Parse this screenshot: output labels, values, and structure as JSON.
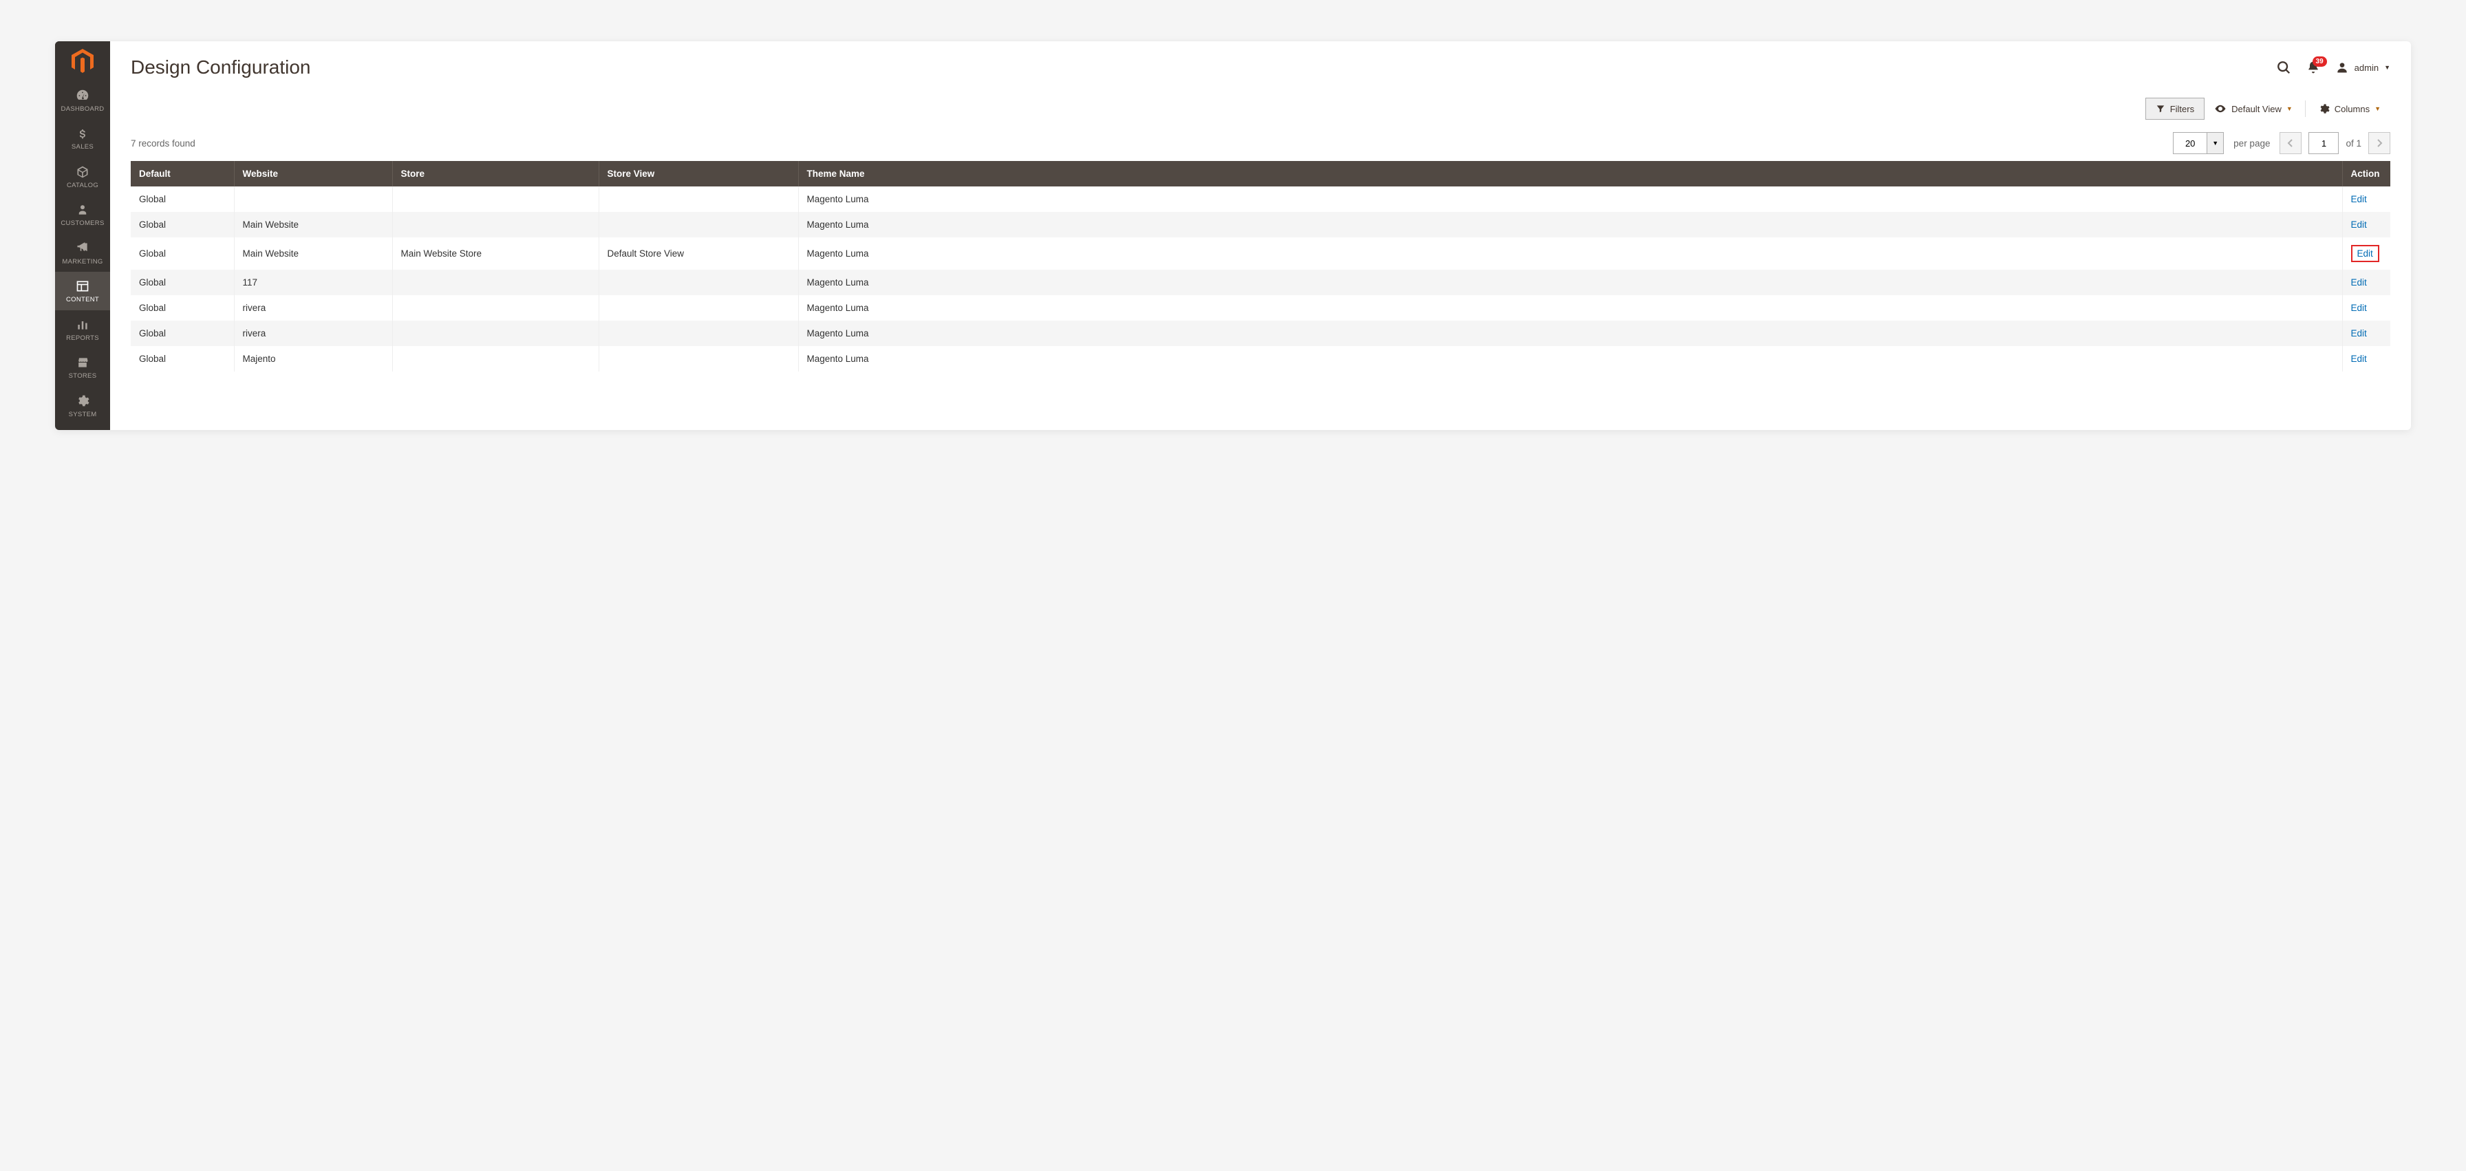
{
  "sidebar": {
    "items": [
      {
        "label": "DASHBOARD",
        "icon": "dashboard"
      },
      {
        "label": "SALES",
        "icon": "dollar"
      },
      {
        "label": "CATALOG",
        "icon": "box"
      },
      {
        "label": "CUSTOMERS",
        "icon": "person"
      },
      {
        "label": "MARKETING",
        "icon": "megaphone"
      },
      {
        "label": "CONTENT",
        "icon": "layout",
        "active": true
      },
      {
        "label": "REPORTS",
        "icon": "bars"
      },
      {
        "label": "STORES",
        "icon": "storefront"
      },
      {
        "label": "SYSTEM",
        "icon": "gear"
      }
    ]
  },
  "header": {
    "title": "Design Configuration",
    "notification_count": "39",
    "user_name": "admin"
  },
  "toolbar": {
    "filters_label": "Filters",
    "default_view_label": "Default View",
    "columns_label": "Columns"
  },
  "pager": {
    "records_found": "7 records found",
    "per_page_value": "20",
    "per_page_label": "per page",
    "page_value": "1",
    "of_total": "of 1"
  },
  "table": {
    "headers": [
      "Default",
      "Website",
      "Store",
      "Store View",
      "Theme Name",
      "Action"
    ],
    "rows": [
      {
        "default": "Global",
        "website": "",
        "store": "",
        "store_view": "",
        "theme": "Magento Luma",
        "action": "Edit"
      },
      {
        "default": "Global",
        "website": "Main Website",
        "store": "",
        "store_view": "",
        "theme": "Magento Luma",
        "action": "Edit"
      },
      {
        "default": "Global",
        "website": "Main Website",
        "store": "Main Website Store",
        "store_view": "Default Store View",
        "theme": "Magento Luma",
        "action": "Edit",
        "highlighted": true
      },
      {
        "default": "Global",
        "website": "117",
        "store": "",
        "store_view": "",
        "theme": "Magento Luma",
        "action": "Edit"
      },
      {
        "default": "Global",
        "website": "rivera",
        "store": "",
        "store_view": "",
        "theme": "Magento Luma",
        "action": "Edit"
      },
      {
        "default": "Global",
        "website": "rivera",
        "store": "",
        "store_view": "",
        "theme": "Magento Luma",
        "action": "Edit"
      },
      {
        "default": "Global",
        "website": "Majento",
        "store": "",
        "store_view": "",
        "theme": "Magento Luma",
        "action": "Edit"
      }
    ]
  }
}
